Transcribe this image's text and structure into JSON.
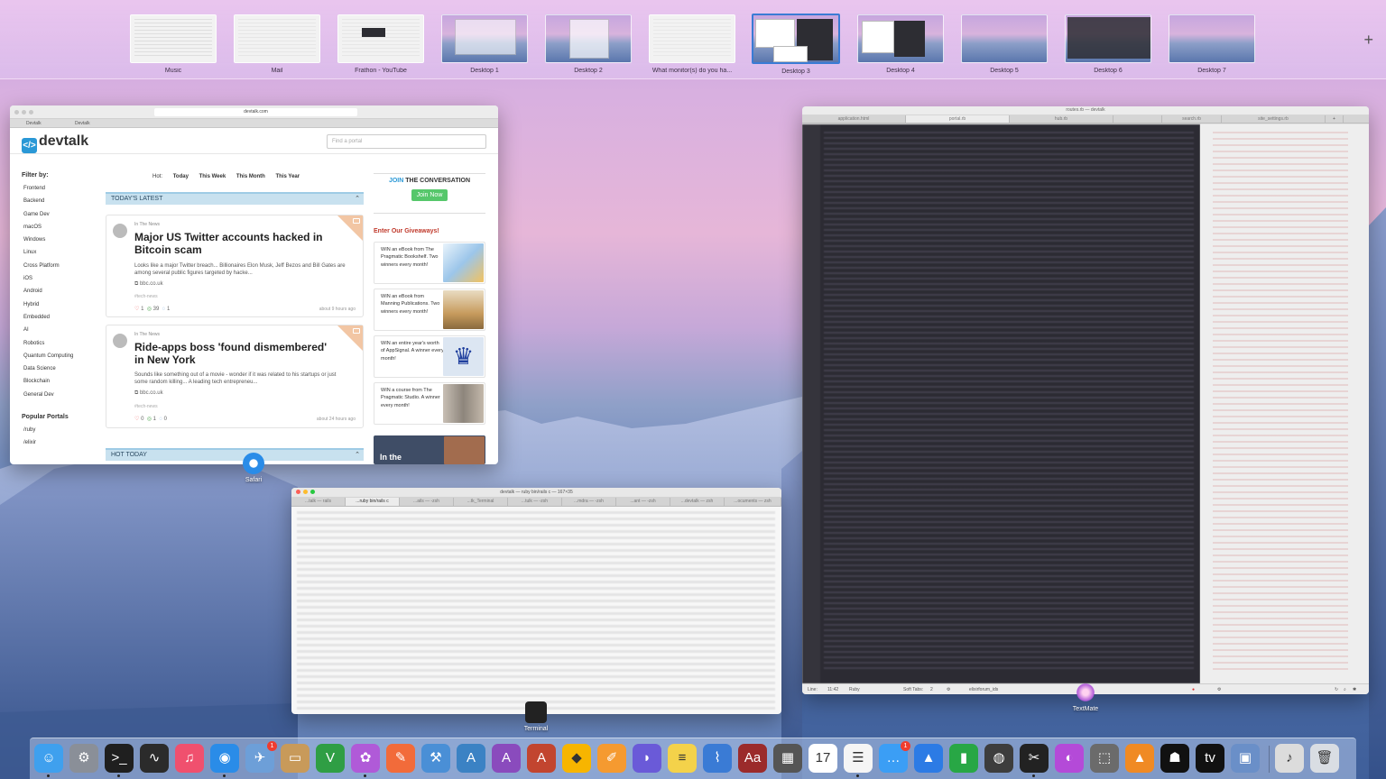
{
  "spaces": [
    {
      "label": "Music"
    },
    {
      "label": "Mail"
    },
    {
      "label": "Frathon - YouTube"
    },
    {
      "label": "Desktop 1"
    },
    {
      "label": "Desktop 2"
    },
    {
      "label": "What monitor(s) do you ha..."
    },
    {
      "label": "Desktop 3",
      "selected": true
    },
    {
      "label": "Desktop 4"
    },
    {
      "label": "Desktop 5"
    },
    {
      "label": "Desktop 6"
    },
    {
      "label": "Desktop 7"
    }
  ],
  "add_space": "+",
  "safari": {
    "app_label": "Safari",
    "url": "devtalk.com",
    "tabs": [
      "Devtalk",
      "Devtalk"
    ],
    "logo": "devtalk",
    "search_placeholder": "Find a portal",
    "filter_title": "Filter by:",
    "filters": [
      "Frontend",
      "Backend",
      "Game Dev",
      "macOS",
      "Windows",
      "Linux",
      "Cross Platform",
      "iOS",
      "Android",
      "Hybrid",
      "Embedded",
      "AI",
      "Robotics",
      "Quantum Computing",
      "Data Science",
      "Blockchain",
      "General Dev"
    ],
    "popular_title": "Popular Portals",
    "portals": [
      "/ruby",
      "/elixir"
    ],
    "hot_label": "Hot:",
    "hot_options": [
      "Today",
      "This Week",
      "This Month",
      "This Year"
    ],
    "latest_heading": "TODAY'S LATEST",
    "hot_today_heading": "HOT TODAY",
    "posts": [
      {
        "category": "In The News",
        "title": "Major US Twitter accounts hacked in Bitcoin scam",
        "excerpt": "Looks like a major Twitter breach... Billionaires Elon Musk, Jeff Bezos and Bill Gates are among several public figures targeted by hacke...",
        "source": "bbc.co.uk",
        "tag": "#tech-news",
        "hearts": "1",
        "views": "39",
        "comments": "1",
        "time": "about 9 hours ago"
      },
      {
        "category": "In The News",
        "title": "Ride-apps boss 'found dismembered' in New York",
        "excerpt": "Sounds like something out of a movie - wonder if it was related to his startups or just some random killing... A leading tech entrepreneu...",
        "source": "bbc.co.uk",
        "tag": "#tech-news",
        "hearts": "0",
        "views": "1",
        "comments": "0",
        "time": "about 24 hours ago"
      }
    ],
    "join_prefix": "JOIN",
    "join_suffix": "THE CONVERSATION",
    "join_button": "Join Now",
    "giveaways_title": "Enter Our Giveaways!",
    "giveaways": [
      {
        "text": "WIN an eBook from The Pragmatic Bookshelf. Two winners every month!"
      },
      {
        "text": "WIN an eBook from Manning Publications. Two winners every month!"
      },
      {
        "text": "WIN an entire year's worth of AppSignal. A winner every month!"
      },
      {
        "text": "WIN a course from The Pragmatic Studio. A winner every month!"
      }
    ],
    "promo_text": "In the"
  },
  "textmate": {
    "app_label": "TextMate",
    "title": "routes.rb — devtalk",
    "tabs": [
      "application.html",
      "portal.rb",
      "hub.rb",
      "",
      "search.rb",
      "site_settings.rb"
    ],
    "status": {
      "line": "Line:",
      "pos": "11:42",
      "lang": "Ruby",
      "tabs": "Soft Tabs:",
      "tab_size": "2",
      "symbol": "elixirforum_ids"
    }
  },
  "terminal": {
    "app_label": "Terminal",
    "title": "devtalk — ruby bin/rails c — 167×35",
    "tabs": [
      "...talk — rails",
      "...ruby bin/rails c",
      "...ails — -zsh",
      "...tk_Terminal",
      "...tulk — -zsh",
      "...mdra — -zsh",
      "...ant — -zsh",
      "...devtalk — zsh",
      "...ocuments — zsh"
    ]
  },
  "dock": {
    "apps": [
      {
        "name": "finder",
        "glyph": "☺",
        "color": "#3fa0ee"
      },
      {
        "name": "system-preferences",
        "glyph": "⚙",
        "color": "#8a8f98"
      },
      {
        "name": "terminal",
        "glyph": ">_",
        "color": "#1f1f1f"
      },
      {
        "name": "activity-monitor",
        "glyph": "∿",
        "color": "#2b2b2b"
      },
      {
        "name": "music",
        "glyph": "♫",
        "color": "#f0506e"
      },
      {
        "name": "safari",
        "glyph": "◉",
        "color": "#2a8ce8"
      },
      {
        "name": "mail-bird",
        "glyph": "✈",
        "color": "#6d9fd8",
        "badge": "1"
      },
      {
        "name": "notefile",
        "glyph": "▭",
        "color": "#c89a5a"
      },
      {
        "name": "vim",
        "glyph": "V",
        "color": "#2f9e44"
      },
      {
        "name": "textmate",
        "glyph": "✿",
        "color": "#b05ad8"
      },
      {
        "name": "postman",
        "glyph": "✎",
        "color": "#f26b3a"
      },
      {
        "name": "xcode-tools",
        "glyph": "⚒",
        "color": "#4a8fd6"
      },
      {
        "name": "affinity-designer",
        "glyph": "A",
        "color": "#3b82c4"
      },
      {
        "name": "affinity-photo",
        "glyph": "A",
        "color": "#8a4bbd"
      },
      {
        "name": "affinity-publisher",
        "glyph": "A",
        "color": "#c2452f"
      },
      {
        "name": "sketch",
        "glyph": "◆",
        "color": "#f7b500"
      },
      {
        "name": "pages",
        "glyph": "✐",
        "color": "#f59a30"
      },
      {
        "name": "nova",
        "glyph": "◗",
        "color": "#6a5ad8"
      },
      {
        "name": "notes",
        "glyph": "≡",
        "color": "#f4d24a"
      },
      {
        "name": "pixelmator",
        "glyph": "⌇",
        "color": "#3a7bd5"
      },
      {
        "name": "dictionary",
        "glyph": "Aa",
        "color": "#9b2b2b"
      },
      {
        "name": "calculator",
        "glyph": "▦",
        "color": "#555555"
      },
      {
        "name": "calendar",
        "glyph": "17",
        "color": "#ffffff"
      },
      {
        "name": "reminders",
        "glyph": "☰",
        "color": "#f5f5f5"
      },
      {
        "name": "messages",
        "glyph": "…",
        "color": "#3b9ef5",
        "badge": "1"
      },
      {
        "name": "keynote",
        "glyph": "▲",
        "color": "#2c7be5"
      },
      {
        "name": "numbers",
        "glyph": "▮",
        "color": "#28a745"
      },
      {
        "name": "disk-utility",
        "glyph": "◍",
        "color": "#3d3d3d"
      },
      {
        "name": "final-cut-pro",
        "glyph": "✂",
        "color": "#222222"
      },
      {
        "name": "motion",
        "glyph": "◐",
        "color": "#b44ad8"
      },
      {
        "name": "compressor",
        "glyph": "⬚",
        "color": "#6b6b6b"
      },
      {
        "name": "vlc",
        "glyph": "▲",
        "color": "#f08a24"
      },
      {
        "name": "kindle",
        "glyph": "☗",
        "color": "#111111"
      },
      {
        "name": "apple-tv",
        "glyph": "tv",
        "color": "#111111"
      },
      {
        "name": "preview",
        "glyph": "▣",
        "color": "#6a8fc8"
      },
      {
        "name": "music-stack",
        "glyph": "♪",
        "color": "#dcdcdc"
      },
      {
        "name": "trash",
        "glyph": "🗑",
        "color": "#d9dde3"
      }
    ]
  }
}
